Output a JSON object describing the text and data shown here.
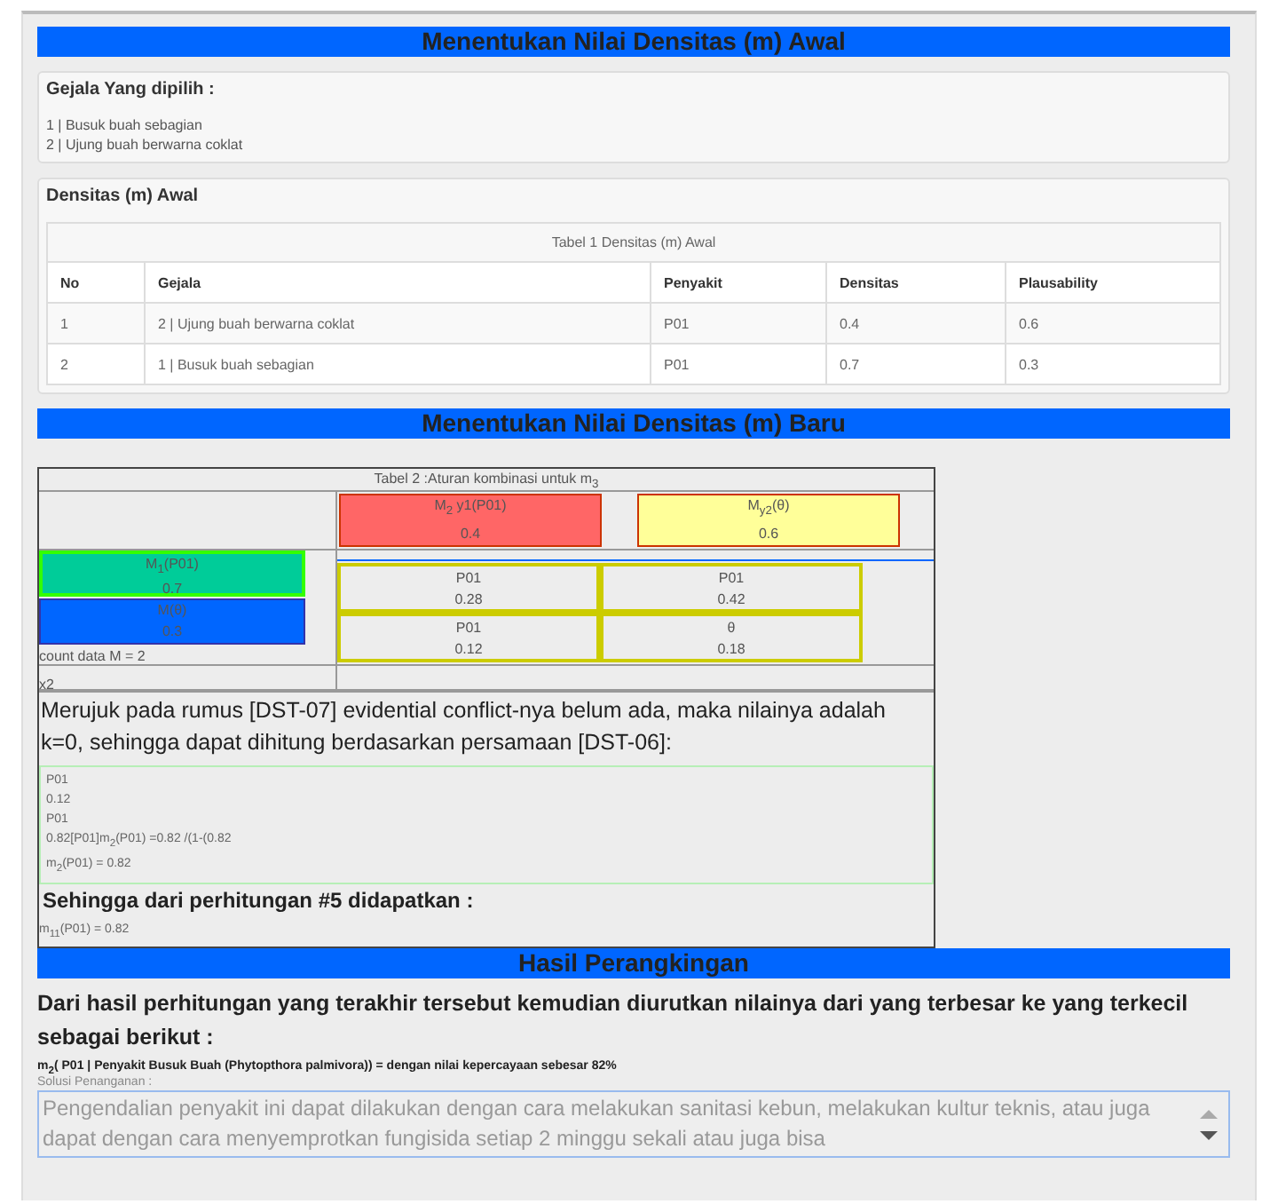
{
  "sections": [
    {
      "title": "Menentukan Nilai Densitas (m) Awal"
    },
    {
      "title": "Menentukan Nilai Densitas (m) Baru"
    },
    {
      "title": "Hasil Perangkingan"
    }
  ],
  "selected_symptoms": {
    "heading": "Gejala Yang dipilih :",
    "items": [
      "1 | Busuk buah sebagian",
      "2 | Ujung buah berwarna coklat"
    ]
  },
  "initial_density": {
    "heading": "Densitas (m) Awal",
    "caption": "Tabel 1 Densitas (m) Awal",
    "columns": [
      "No",
      "Gejala",
      "Penyakit",
      "Densitas",
      "Plausability"
    ],
    "rows": [
      [
        "1",
        "2 | Ujung buah berwarna coklat",
        "P01",
        "0.4",
        "0.6"
      ],
      [
        "2",
        "1 | Busuk buah sebagian",
        "P01",
        "0.7",
        "0.3"
      ]
    ]
  },
  "combination": {
    "caption": "Tabel 2 :Aturan kombinasi untuk m$_{3}$",
    "columns": [
      {
        "label": "M$_{2}$ y1(P01)",
        "value": "0.4",
        "color": "#ff6666"
      },
      {
        "label": "M$_{y2}$(θ)",
        "value": "0.6",
        "color": "#ffff99"
      }
    ],
    "rows": [
      {
        "label": "M$_{1}$(P01)",
        "value": "0.7",
        "color": "#00cc99"
      },
      {
        "label": "M(θ)",
        "value": "0.3",
        "color": "#0066ff"
      }
    ],
    "cells": [
      [
        {
          "label": "P01",
          "value": "0.28"
        },
        {
          "label": "P01",
          "value": "0.42"
        }
      ],
      [
        {
          "label": "P01",
          "value": "0.12"
        },
        {
          "label": "θ",
          "value": "0.18"
        }
      ]
    ],
    "count": "count data M = 2",
    "note": "x2",
    "explanation": "Merujuk pada rumus [DST-07] evidential conflict-nya belum ada, maka nilainya adalah k=0, sehingga dapat dihitung berdasarkan persamaan [DST-06]:",
    "calculation": [
      "P01",
      "0.12",
      "P01",
      "0.82[P01]m$_{2}$(P01) =0.82 /(1-(0.82",
      "m$_{2}$(P01) = 0.82"
    ],
    "subheading": "Sehingga dari perhitungan #5 didapatkan :",
    "result": "m$_{11}$(P01) = 0.82"
  },
  "ranking": {
    "intro": "Dari hasil perhitungan yang terakhir tersebut kemudian diurutkan nilainya dari yang terbesar ke yang terkecil sebagai berikut :",
    "result": "m$_{2}$( P01 | Penyakit Busuk Buah (Phytopthora palmivora)) = dengan nilai kepercayaan sebesar 82%",
    "solution_label": "Solusi Penanganan :",
    "solution": "Pengendalian penyakit ini dapat dilakukan dengan cara melakukan sanitasi kebun, melakukan kultur teknis, atau juga dapat dengan cara menyemprotkan fungisida setiap 2 minggu sekali atau juga bisa"
  }
}
